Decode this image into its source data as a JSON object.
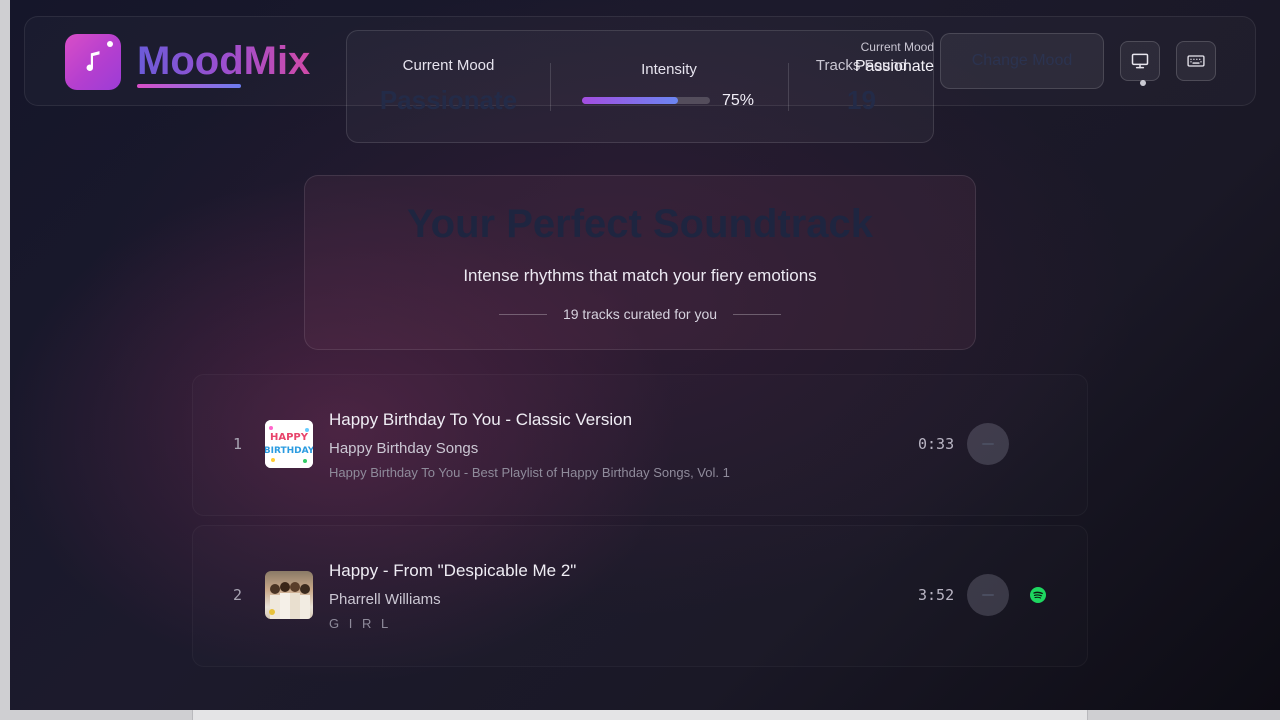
{
  "app": {
    "brand": "MoodMix"
  },
  "header": {
    "current_mood_label": "Current Mood",
    "current_mood_value": "Passionate",
    "intensity_label": "Intensity",
    "intensity_value": 0.75,
    "intensity_text": "75%",
    "tracks_found_label": "Tracks Found",
    "tracks_found_value": "19",
    "tooltip_label": "Current Mood",
    "tooltip_value": "Passionate",
    "change_mood_label": "Change Mood",
    "icons": [
      "monitor-icon",
      "keyboard-icon"
    ]
  },
  "hero": {
    "title": "Your Perfect Soundtrack",
    "subtitle": "Intense rhythms that match your fiery emotions",
    "count_text": "19 tracks curated for you"
  },
  "tracks": [
    {
      "number": "1",
      "title": "Happy Birthday To You - Classic Version",
      "artist": "Happy Birthday Songs",
      "album": "Happy Birthday To You - Best Playlist of Happy Birthday Songs, Vol. 1",
      "duration": "0:33",
      "art_text": [
        "HAPPY",
        "BIRTHDAY"
      ],
      "spotify": false
    },
    {
      "number": "2",
      "title": "Happy - From \"Despicable Me 2\"",
      "artist": "Pharrell Williams",
      "album": "G I R L",
      "duration": "3:52",
      "spotify": true
    }
  ],
  "colors": {
    "accent_pink": "#d94ec7",
    "accent_purple": "#9c3cd6",
    "accent_blue": "#6b86f2",
    "spotify_green": "#1ed760"
  }
}
